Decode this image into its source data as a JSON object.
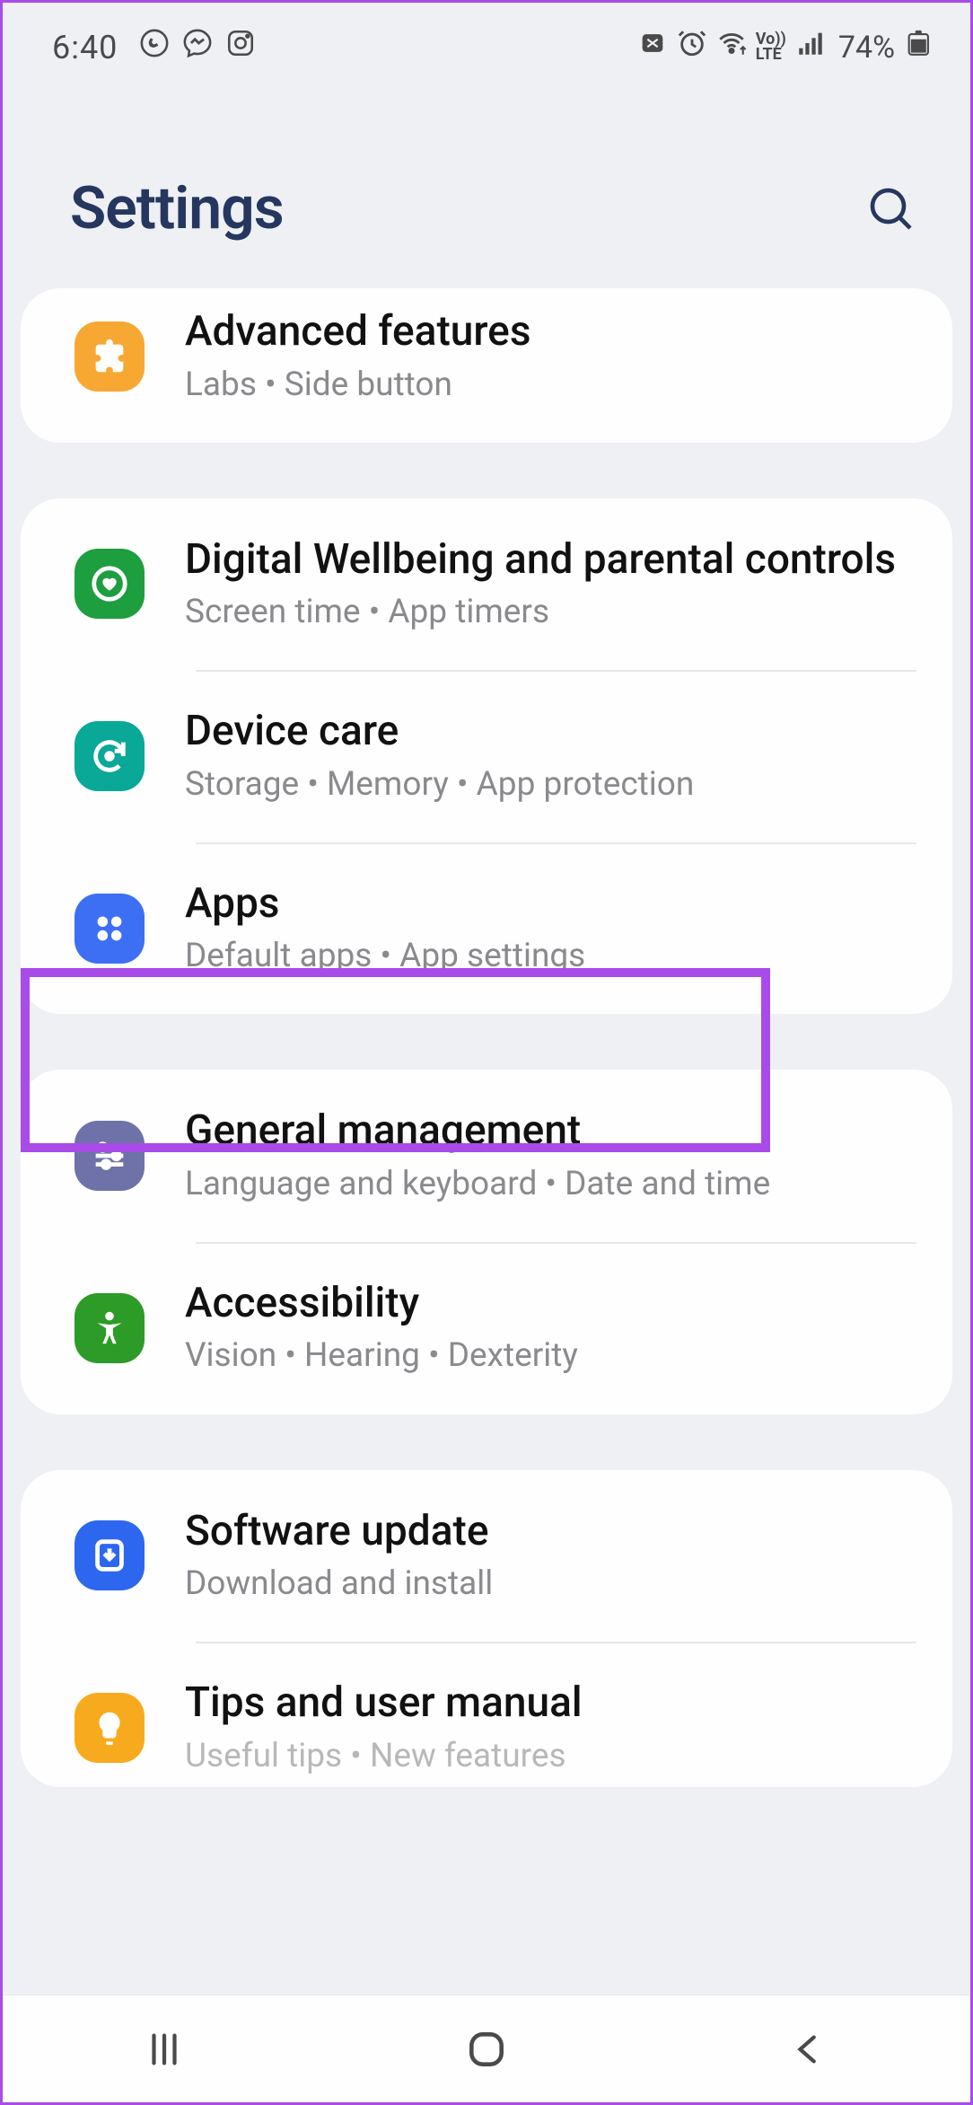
{
  "status": {
    "time": "6:40",
    "battery": "74%"
  },
  "header": {
    "title": "Settings"
  },
  "groups": [
    {
      "items": [
        {
          "icon": "puzzle",
          "color": "ic-orange",
          "title": "Advanced features",
          "sub": "Labs  •  Side button",
          "highlight": false
        }
      ]
    },
    {
      "items": [
        {
          "icon": "heart-shield",
          "color": "ic-green",
          "title": "Digital Wellbeing and parental controls",
          "sub": "Screen time  •  App timers",
          "highlight": false
        },
        {
          "icon": "refresh-care",
          "color": "ic-teal",
          "title": "Device care",
          "sub": "Storage  •  Memory  •  App protection",
          "highlight": false
        },
        {
          "icon": "dots4",
          "color": "ic-blue",
          "title": "Apps",
          "sub": "Default apps  •  App settings",
          "highlight": true
        }
      ]
    },
    {
      "items": [
        {
          "icon": "sliders",
          "color": "ic-purple",
          "title": "General management",
          "sub": "Language and keyboard  •  Date and time",
          "highlight": false
        },
        {
          "icon": "person",
          "color": "ic-green2",
          "title": "Accessibility",
          "sub": "Vision  •  Hearing  •  Dexterity",
          "highlight": false
        }
      ]
    },
    {
      "items": [
        {
          "icon": "download",
          "color": "ic-blue2",
          "title": "Software update",
          "sub": "Download and install",
          "highlight": false
        },
        {
          "icon": "bulb",
          "color": "ic-yellow",
          "title": "Tips and user manual",
          "sub": "Useful tips  •  New features",
          "highlight": false
        }
      ]
    }
  ]
}
